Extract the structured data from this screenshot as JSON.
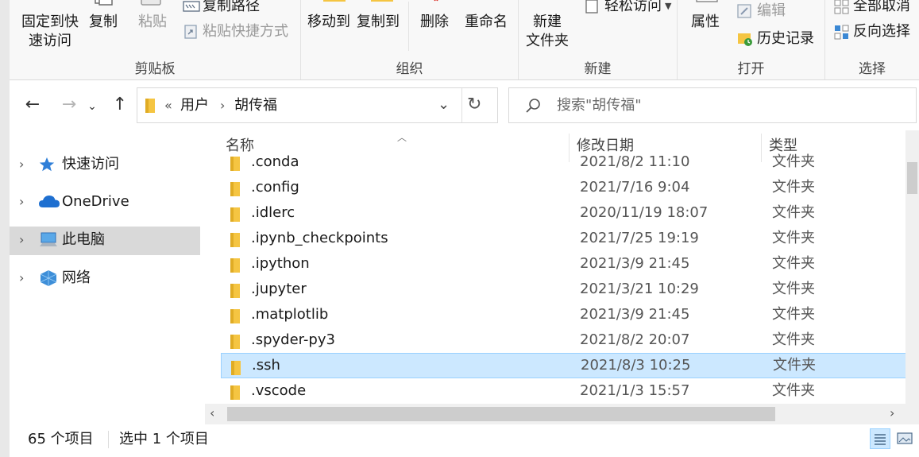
{
  "ribbon": {
    "clipboard": {
      "pin_label_1": "固定到快",
      "pin_label_2": "速访问",
      "copy": "复制",
      "paste": "粘贴",
      "copy_path": "复制路径",
      "paste_shortcut": "粘贴快捷方式",
      "group": "剪贴板"
    },
    "organize": {
      "move_to": "移动到",
      "copy_to": "复制到",
      "delete": "删除",
      "rename": "重命名",
      "group": "组织"
    },
    "new": {
      "new_folder_1": "新建",
      "new_folder_2": "文件夹",
      "easy_access": "轻松访问",
      "group": "新建"
    },
    "open": {
      "properties": "属性",
      "edit": "编辑",
      "history": "历史记录",
      "group": "打开"
    },
    "select": {
      "select_all": "全部取消",
      "invert": "反向选择",
      "group": "选择"
    }
  },
  "address": {
    "overflow": "«",
    "crumbs": [
      "用户",
      "胡传福"
    ],
    "separator": "›"
  },
  "search": {
    "placeholder": "搜索\"胡传福\""
  },
  "nav_pane": {
    "items": [
      {
        "label": "快速访问",
        "icon": "star-icon"
      },
      {
        "label": "OneDrive",
        "icon": "cloud-icon"
      },
      {
        "label": "此电脑",
        "icon": "computer-icon"
      },
      {
        "label": "网络",
        "icon": "network-icon"
      }
    ]
  },
  "columns": {
    "name": "名称",
    "modified": "修改日期",
    "type": "类型"
  },
  "files": [
    {
      "name": ".conda",
      "date": "2021/8/2 11:10",
      "type": "文件夹"
    },
    {
      "name": ".config",
      "date": "2021/7/16 9:04",
      "type": "文件夹"
    },
    {
      "name": ".idlerc",
      "date": "2020/11/19 18:07",
      "type": "文件夹"
    },
    {
      "name": ".ipynb_checkpoints",
      "date": "2021/7/25 19:19",
      "type": "文件夹"
    },
    {
      "name": ".ipython",
      "date": "2021/3/9 21:45",
      "type": "文件夹"
    },
    {
      "name": ".jupyter",
      "date": "2021/3/21 10:29",
      "type": "文件夹"
    },
    {
      "name": ".matplotlib",
      "date": "2021/3/9 21:45",
      "type": "文件夹"
    },
    {
      "name": ".spyder-py3",
      "date": "2021/8/2 20:07",
      "type": "文件夹"
    },
    {
      "name": ".ssh",
      "date": "2021/8/3 10:25",
      "type": "文件夹"
    },
    {
      "name": ".vscode",
      "date": "2021/1/3 15:57",
      "type": "文件夹"
    }
  ],
  "status": {
    "count": "65 个项目",
    "selected": "选中 1 个项目"
  },
  "colors": {
    "selection": "#cce8ff",
    "selection_border": "#99d1ff",
    "folder": "#f5c542"
  }
}
